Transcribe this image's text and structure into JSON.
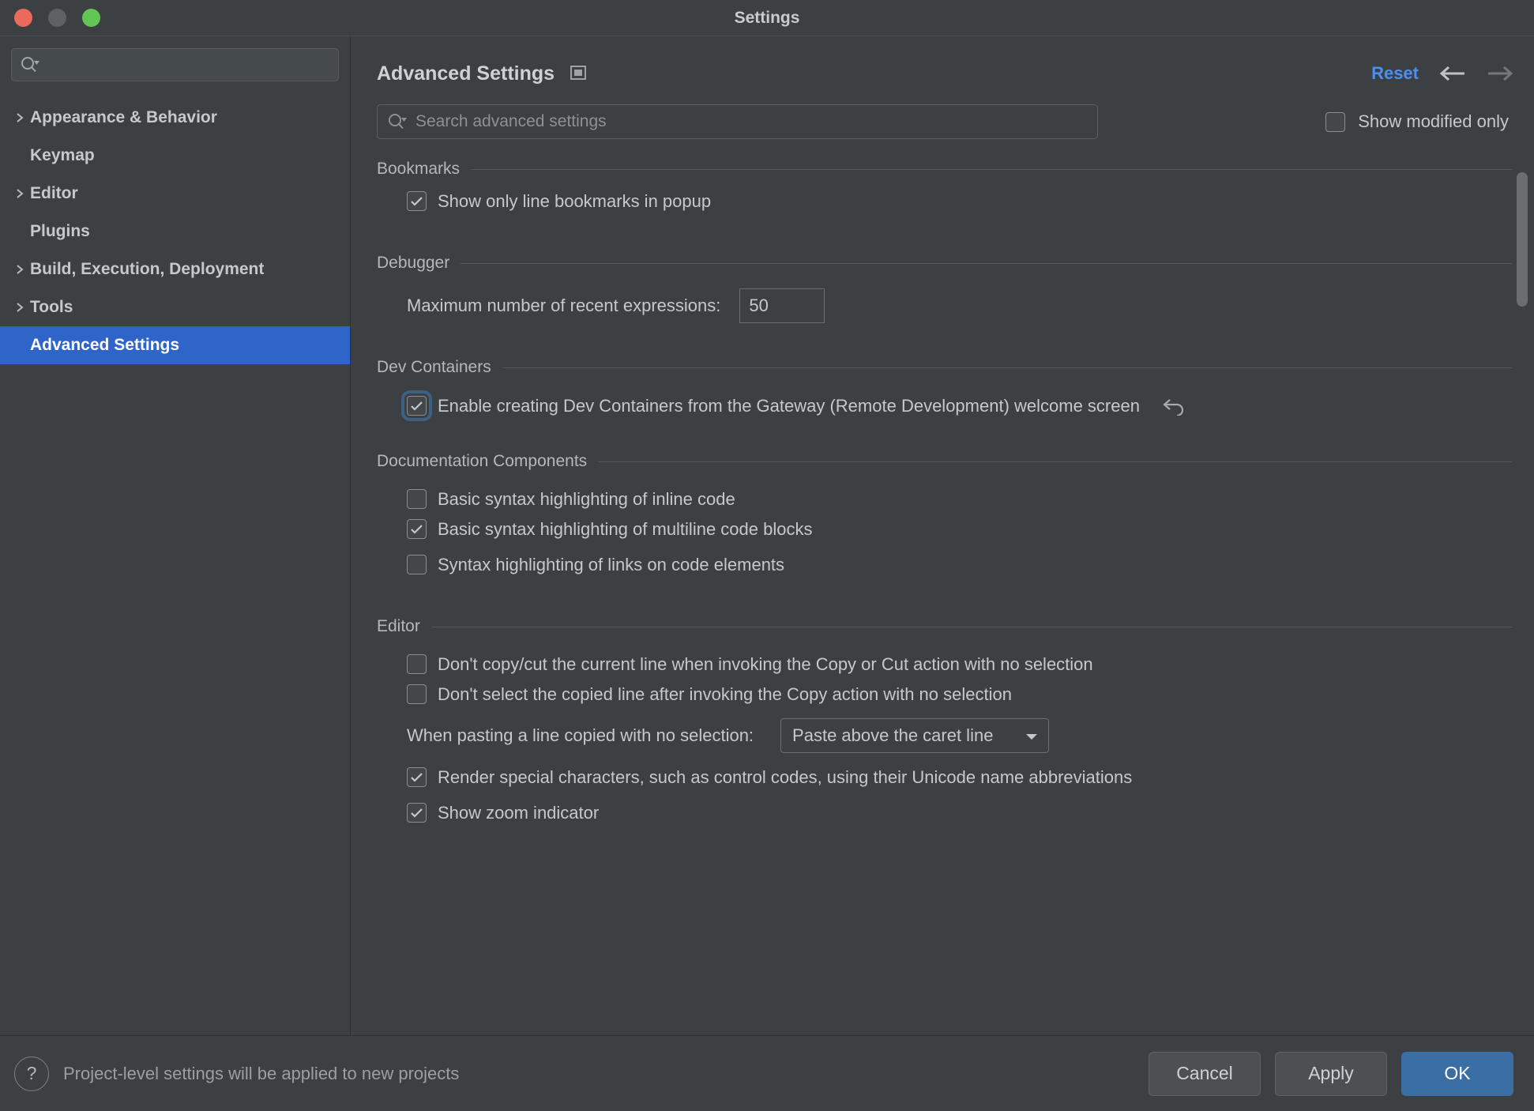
{
  "window": {
    "title": "Settings",
    "traffic_lights": [
      "close-button",
      "minimize-button",
      "zoom-button"
    ]
  },
  "sidebar": {
    "search_placeholder": "",
    "items": [
      {
        "label": "Appearance & Behavior",
        "expandable": true,
        "selected": false
      },
      {
        "label": "Keymap",
        "expandable": false,
        "selected": false
      },
      {
        "label": "Editor",
        "expandable": true,
        "selected": false
      },
      {
        "label": "Plugins",
        "expandable": false,
        "selected": false
      },
      {
        "label": "Build, Execution, Deployment",
        "expandable": true,
        "selected": false
      },
      {
        "label": "Tools",
        "expandable": true,
        "selected": false
      },
      {
        "label": "Advanced Settings",
        "expandable": false,
        "selected": true
      }
    ]
  },
  "header": {
    "title": "Advanced Settings",
    "reset_label": "Reset",
    "back_arrow": "←",
    "forward_arrow": "→"
  },
  "search": {
    "placeholder": "Search advanced settings",
    "value": ""
  },
  "modified_filter": {
    "label": "Show modified only",
    "checked": false
  },
  "sections": [
    {
      "title": "Bookmarks",
      "rows": [
        {
          "type": "checkbox",
          "label": "Show only line bookmarks in popup",
          "checked": true
        }
      ]
    },
    {
      "title": "Debugger",
      "rows": [
        {
          "type": "number",
          "label": "Maximum number of recent expressions:",
          "value": "50"
        }
      ]
    },
    {
      "title": "Dev Containers",
      "rows": [
        {
          "type": "checkbox",
          "label": "Enable creating Dev Containers from the Gateway (Remote Development) welcome screen",
          "checked": true,
          "focused": true,
          "revert": true
        }
      ]
    },
    {
      "title": "Documentation Components",
      "rows": [
        {
          "type": "checkbox",
          "label": "Basic syntax highlighting of inline code",
          "checked": false
        },
        {
          "type": "checkbox",
          "label": "Basic syntax highlighting of multiline code blocks",
          "checked": true
        },
        {
          "type": "checkbox",
          "label": "Syntax highlighting of links on code elements",
          "checked": false
        }
      ]
    },
    {
      "title": "Editor",
      "rows": [
        {
          "type": "checkbox",
          "label": "Don't copy/cut the current line when invoking the Copy or Cut action with no selection",
          "checked": false
        },
        {
          "type": "checkbox",
          "label": "Don't select the copied line after invoking the Copy action with no selection",
          "checked": false
        },
        {
          "type": "combo",
          "label": "When pasting a line copied with no selection:",
          "value": "Paste above the caret line"
        },
        {
          "type": "checkbox",
          "label": "Render special characters, such as control codes, using their Unicode name abbreviations",
          "checked": true
        },
        {
          "type": "checkbox",
          "label": "Show zoom indicator",
          "checked": true
        }
      ]
    }
  ],
  "footer": {
    "note": "Project-level settings will be applied to new projects",
    "help_glyph": "?",
    "cancel_label": "Cancel",
    "apply_label": "Apply",
    "ok_label": "OK"
  },
  "colors": {
    "window_bg": "#3c4043",
    "selection_blue": "#2f65c9",
    "link_blue": "#4d8ff0",
    "primary_button": "#3a6ea5",
    "text": "#c6c9cb",
    "muted_text": "#9c9fa2"
  }
}
